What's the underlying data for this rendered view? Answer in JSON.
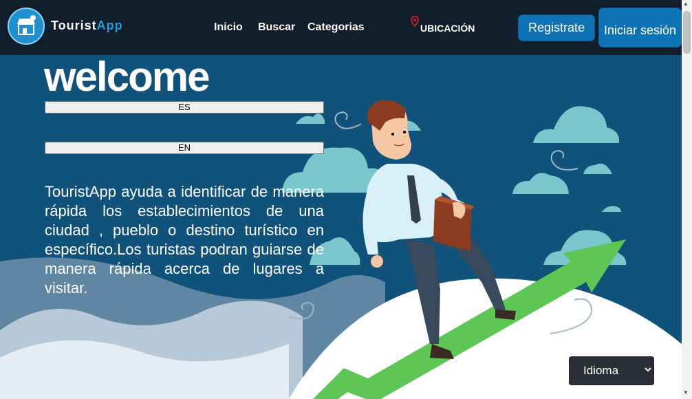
{
  "header": {
    "brand_main": "Tourist",
    "brand_accent": "App",
    "nav": [
      "Inicio",
      "Buscar",
      "Categorias"
    ],
    "location_label": "UBICACIÓN",
    "register_label": "Registrate",
    "login_label": "Iniciar sesión"
  },
  "hero": {
    "welcome": "welcome",
    "lang_buttons": [
      "ES",
      "EN"
    ],
    "description": "TouristApp ayuda a identificar de manera rápida los establecimientos de una ciudad , pueblo o destino turístico en específico.Los turistas podran guiarse de manera rápida acerca de lugares a visitar.",
    "language_select": "Idioma"
  },
  "colors": {
    "navbar": "#131e2c",
    "accent": "#0d73b4",
    "sky": "#10527a",
    "cloud": "#79c6cd",
    "arrow": "#5ec655"
  },
  "icons": [
    "storefront-logo-icon",
    "map-pin-icon",
    "chevron-down-icon"
  ]
}
